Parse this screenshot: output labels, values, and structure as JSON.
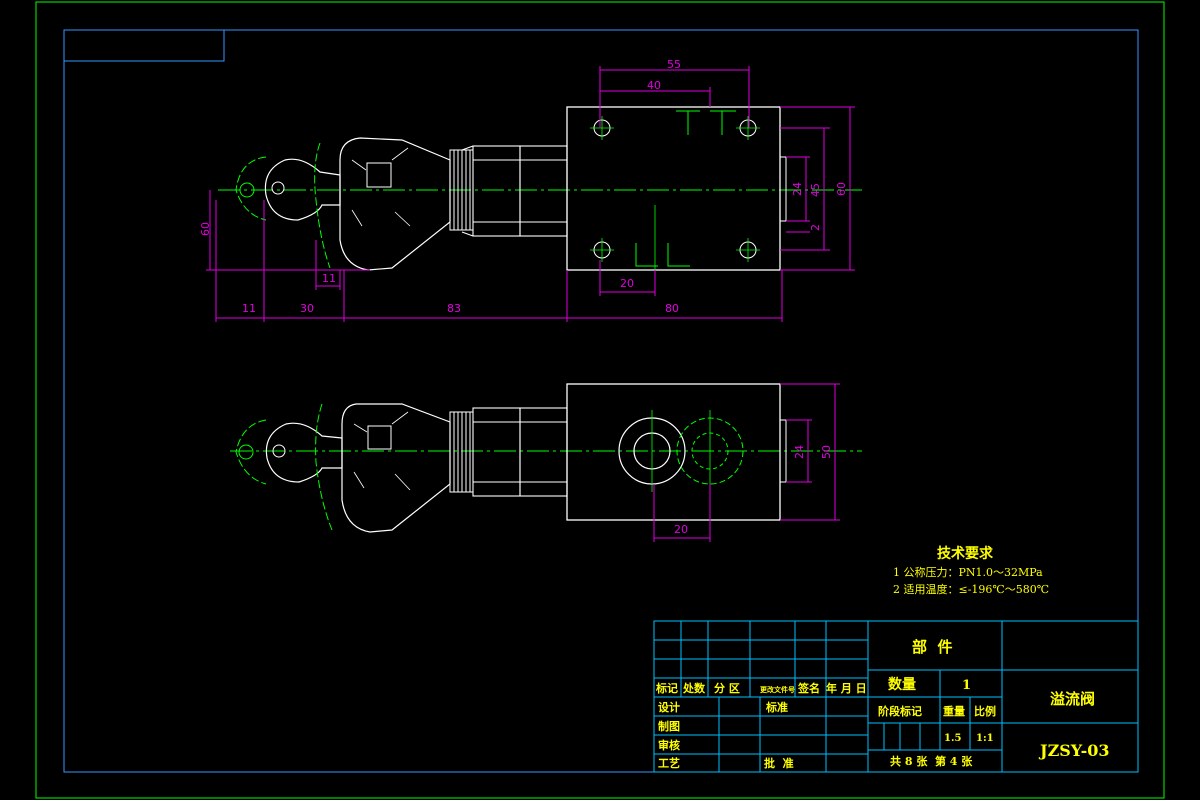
{
  "colors": {
    "background": "#000000",
    "frame": "#00ff00",
    "border": "#3399ff",
    "outline": "#ffffff",
    "centerline": "#00ff00",
    "dimension": "#e000e0",
    "text": "#ffff00",
    "title_grid": "#00bfff"
  },
  "views": {
    "top": {
      "dims_top": [
        "55",
        "40"
      ],
      "dims_right": [
        "24",
        "45",
        "60",
        "2"
      ],
      "dim_bottom_inner": "20",
      "dim_left": "60",
      "dim_mid_small": "11",
      "dims_bottom_chain": [
        "11",
        "30",
        "83",
        "80"
      ]
    },
    "bottom": {
      "dims_right": [
        "24",
        "50"
      ],
      "dim_bottom": "20"
    }
  },
  "tech_requirements": {
    "title": "技术要求",
    "items": [
      "1 公称压力：PN1.0～32MPa",
      "2 适用温度：≤-196℃～580℃"
    ]
  },
  "title_block": {
    "part_label": "部  件",
    "drawing_name": "溢流阀",
    "drawing_code": "JZSY-03",
    "quantity_label": "数量",
    "quantity_value": "1",
    "revision_headers": [
      "标记",
      "处数",
      "分 区",
      "更改文件号",
      "签名",
      "年 月 日"
    ],
    "row_labels": [
      "设计",
      "制图",
      "审核",
      "工艺"
    ],
    "standardize_label": "标准",
    "approve_label": "批  准",
    "stage_label": "阶段标记",
    "weight_label": "重量",
    "scale_label": "比例",
    "weight_value": "1.5",
    "scale_value": "1:1",
    "sheets_text": "共 8 张  第 4 张"
  }
}
